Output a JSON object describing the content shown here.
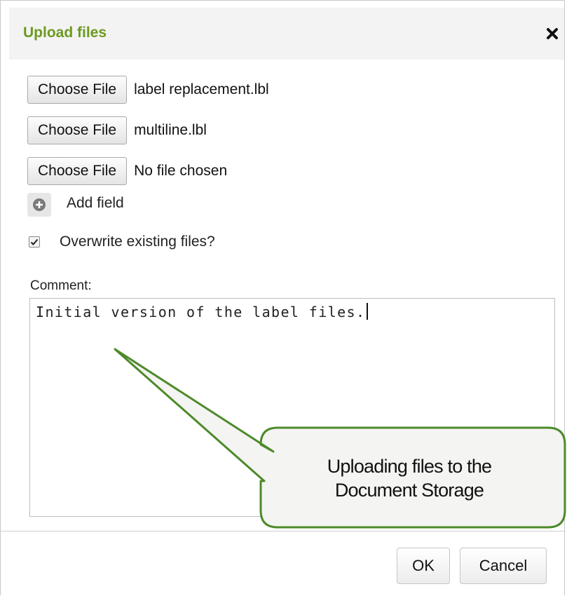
{
  "dialog": {
    "title": "Upload files",
    "close_icon": "close-icon"
  },
  "files": [
    {
      "button_label": "Choose File",
      "file_name": "label replacement.lbl"
    },
    {
      "button_label": "Choose File",
      "file_name": "multiline.lbl"
    },
    {
      "button_label": "Choose File",
      "file_name": "No file chosen"
    }
  ],
  "add_field": {
    "label": "Add field",
    "icon": "plus-circle-icon"
  },
  "overwrite": {
    "label": "Overwrite existing files?",
    "checked": true
  },
  "comment": {
    "label": "Comment:",
    "value": "Initial version of the label files."
  },
  "callout": {
    "line1": "Uploading files to the",
    "line2": "Document Storage"
  },
  "footer": {
    "ok_label": "OK",
    "cancel_label": "Cancel"
  },
  "colors": {
    "title": "#6c9a1f",
    "callout_border": "#4d8a2a",
    "callout_fill": "#f4f4f2"
  }
}
